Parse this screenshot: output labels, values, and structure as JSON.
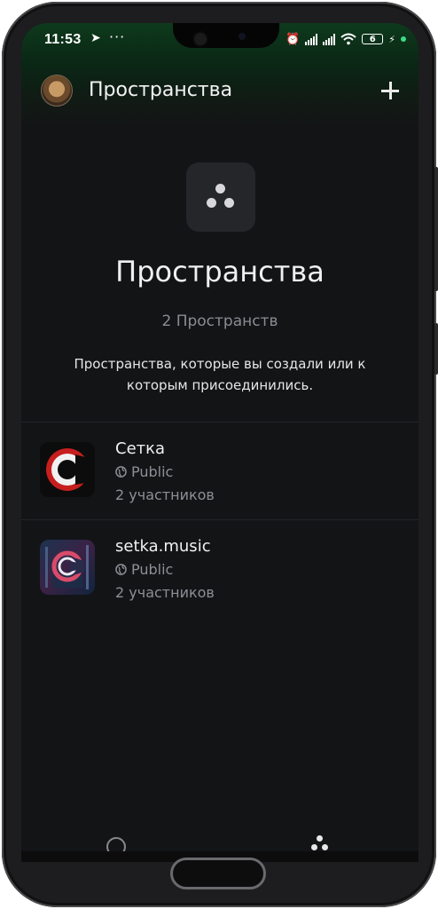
{
  "status_bar": {
    "time": "11:53",
    "battery": "6",
    "icons": [
      "navigation-icon",
      "more-icon",
      "alarm-off-icon",
      "signal-icon",
      "signal-icon",
      "wifi-icon",
      "battery-icon",
      "charging-icon"
    ]
  },
  "header": {
    "title": "Пространства",
    "add_icon": "plus-icon"
  },
  "hero": {
    "icon": "spaces-icon",
    "title": "Пространства",
    "count": "2 Пространств",
    "description": "Пространства, которые вы создали или к которым присоединились."
  },
  "spaces": [
    {
      "name": "Сетка",
      "visibility": "Public",
      "members": "2 участников"
    },
    {
      "name": "setka.music",
      "visibility": "Public",
      "members": "2 участников"
    }
  ],
  "colors": {
    "background": "#131416",
    "header_gradient_top": "#0e3a1c",
    "text_primary": "#f0f0f0",
    "text_secondary": "#8a8c92"
  }
}
